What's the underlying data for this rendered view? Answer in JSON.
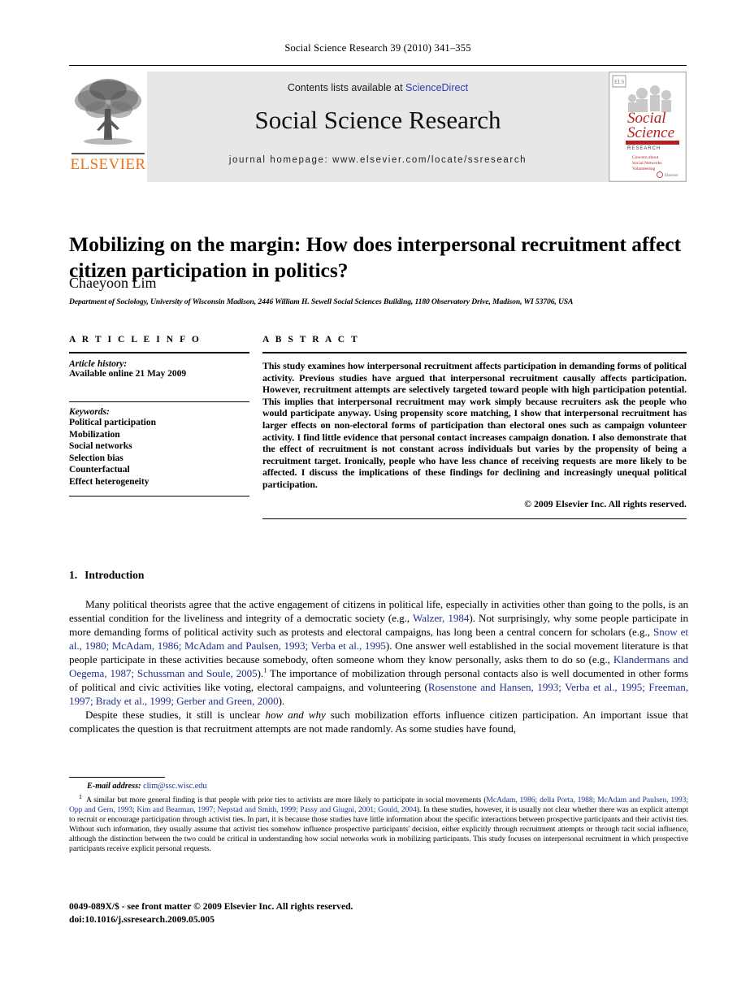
{
  "running_head": "Social Science Research 39 (2010) 341–355",
  "masthead": {
    "contents_prefix": "Contents lists available at ",
    "sciencedirect": "ScienceDirect",
    "journal_name": "Social Science Research",
    "homepage": "journal homepage: www.elsevier.com/locate/ssresearch",
    "publisher_wordmark": "ELSEVIER",
    "cover_title_line1": "Social",
    "cover_title_line2": "Science",
    "cover_subtitle": "RESEARCH",
    "link_color": "#2d3bb0",
    "publisher_color": "#E8731B"
  },
  "article": {
    "title": "Mobilizing on the margin: How does interpersonal recruitment affect citizen participation in politics?",
    "author": "Chaeyoon Lim",
    "affiliation": "Department of Sociology, University of Wisconsin Madison, 2446 William H. Sewell Social Sciences Building, 1180 Observatory Drive, Madison, WI 53706, USA"
  },
  "article_info": {
    "label": "A R T I C L E   I N F O",
    "history_label": "Article history:",
    "history_value": "Available online 21 May 2009",
    "keywords_label": "Keywords:",
    "keywords": [
      "Political participation",
      "Mobilization",
      "Social networks",
      "Selection bias",
      "Counterfactual",
      "Effect heterogeneity"
    ]
  },
  "abstract": {
    "label": "A B S T R A C T",
    "text": "This study examines how interpersonal recruitment affects participation in demanding forms of political activity. Previous studies have argued that interpersonal recruitment causally affects participation. However, recruitment attempts are selectively targeted toward people with high participation potential. This implies that interpersonal recruitment may work simply because recruiters ask the people who would participate anyway. Using propensity score matching, I show that interpersonal recruitment has larger effects on non-electoral forms of participation than electoral ones such as campaign volunteer activity. I find little evidence that personal contact increases campaign donation. I also demonstrate that the effect of recruitment is not constant across individuals but varies by the propensity of being a recruitment target. Ironically, people who have less chance of receiving requests are more likely to be affected. I discuss the implications of these findings for declining and increasingly unequal political participation.",
    "copyright": "© 2009 Elsevier Inc. All rights reserved."
  },
  "introduction": {
    "number": "1.",
    "heading": "Introduction",
    "p1_a": "Many political theorists agree that the active engagement of citizens in political life, especially in activities other than going to the polls, is an essential condition for the liveliness and integrity of a democratic society (e.g., ",
    "p1_cit1": "Walzer, 1984",
    "p1_b": "). Not surprisingly, why some people participate in more demanding forms of political activity such as protests and electoral campaigns, has long been a central concern for scholars (e.g., ",
    "p1_cit2": "Snow et al., 1980; McAdam, 1986; McAdam and Paulsen, 1993; Verba et al., 1995",
    "p1_c": "). One answer well established in the social movement literature is that people participate in these activities because somebody, often someone whom they know personally, asks them to do so (e.g., ",
    "p1_cit3": "Klandermans and Oegema, 1987; Schussman and Soule, 2005",
    "p1_d": ").",
    "p1_e": " The importance of mobilization through personal contacts also is well documented in other forms of political and civic activities like voting, electoral campaigns, and volunteering (",
    "p1_cit4": "Rosenstone and Hansen, 1993; Verba et al., 1995; Freeman, 1997; Brady et al., 1999; Gerber and Green, 2000",
    "p1_f": ").",
    "p2_a": "Despite these studies, it still is unclear ",
    "p2_ital": "how and why",
    "p2_b": " such mobilization efforts influence citizen participation. An important issue that complicates the question is that recruitment attempts are not made randomly. As some studies have found,"
  },
  "footnotes": {
    "email_label": "E-mail address:",
    "email": "clim@ssc.wisc.edu",
    "note_mark": "1",
    "note_a": "A similar but more general finding is that people with prior ties to activists are more likely to participate in social movements (",
    "note_cit": "McAdam, 1986; della Porta, 1988; McAdam and Paulsen, 1993; Opp and Gern, 1993; Kim and Bearman, 1997; Nepstad and Smith, 1999; Passy and Giugni, 2001; Gould, 2004",
    "note_b": "). In these studies, however, it is usually not clear whether there was an explicit attempt to recruit or encourage participation through activist ties. In part, it is because those studies have little information about the specific interactions between prospective participants and their activist ties. Without such information, they usually assume that activist ties somehow influence prospective participants' decision, either explicitly through recruitment attempts or through tacit social influence, although the distinction between the two could be critical in understanding how social networks work in mobilizing participants. This study focuses on interpersonal recruitment in which prospective participants receive explicit personal requests."
  },
  "footer": {
    "issn_line": "0049-089X/$ - see front matter © 2009 Elsevier Inc. All rights reserved.",
    "doi_line": "doi:10.1016/j.ssresearch.2009.05.005"
  }
}
